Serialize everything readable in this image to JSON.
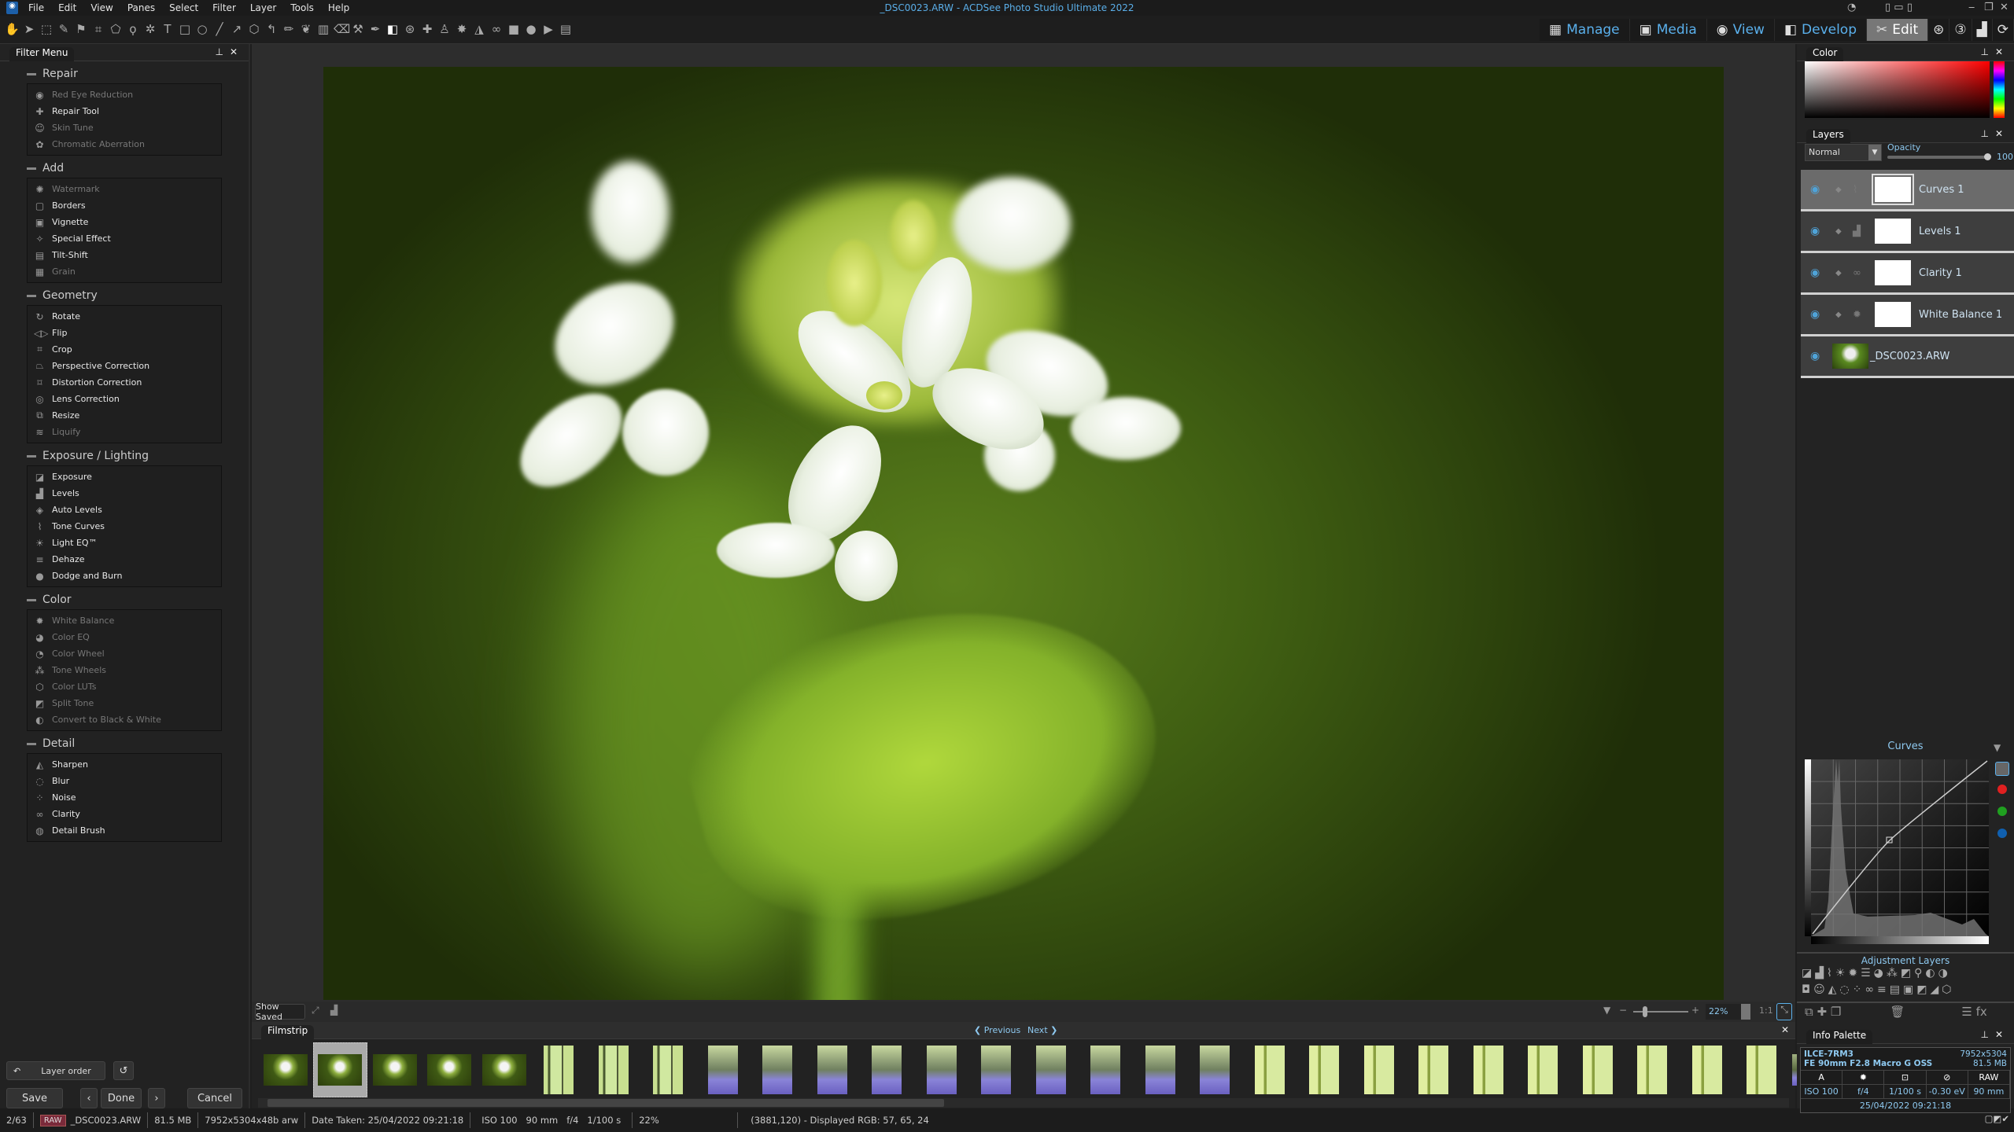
{
  "window": {
    "title": "_DSC0023.ARW - ACDSee Photo Studio Ultimate 2022"
  },
  "menu": [
    "File",
    "Edit",
    "View",
    "Panes",
    "Select",
    "Filter",
    "Layer",
    "Tools",
    "Help"
  ],
  "modes": [
    {
      "label": "Manage",
      "icon": "grid-icon"
    },
    {
      "label": "Media",
      "icon": "media-icon"
    },
    {
      "label": "View",
      "icon": "eye-icon"
    },
    {
      "label": "Develop",
      "icon": "develop-icon"
    },
    {
      "label": "Edit",
      "icon": "edit-icon",
      "active": true
    }
  ],
  "filter_menu": {
    "title": "Filter Menu",
    "sections": [
      {
        "title": "Repair",
        "items": [
          {
            "label": "Red Eye Reduction",
            "disabled": true,
            "icon": "◉"
          },
          {
            "label": "Repair Tool",
            "icon": "✚"
          },
          {
            "label": "Skin Tune",
            "disabled": true,
            "icon": "☺"
          },
          {
            "label": "Chromatic Aberration",
            "disabled": true,
            "icon": "✿"
          }
        ]
      },
      {
        "title": "Add",
        "items": [
          {
            "label": "Watermark",
            "disabled": true,
            "icon": "✺"
          },
          {
            "label": "Borders",
            "icon": "▢"
          },
          {
            "label": "Vignette",
            "icon": "▣"
          },
          {
            "label": "Special Effect",
            "icon": "✧"
          },
          {
            "label": "Tilt-Shift",
            "icon": "▤"
          },
          {
            "label": "Grain",
            "disabled": true,
            "icon": "▦"
          }
        ]
      },
      {
        "title": "Geometry",
        "items": [
          {
            "label": "Rotate",
            "icon": "↻"
          },
          {
            "label": "Flip",
            "icon": "◁▷"
          },
          {
            "label": "Crop",
            "icon": "⌗"
          },
          {
            "label": "Perspective Correction",
            "icon": "⏢"
          },
          {
            "label": "Distortion Correction",
            "icon": "⌑"
          },
          {
            "label": "Lens Correction",
            "icon": "◎"
          },
          {
            "label": "Resize",
            "icon": "⧉"
          },
          {
            "label": "Liquify",
            "disabled": true,
            "icon": "≋"
          }
        ]
      },
      {
        "title": "Exposure / Lighting",
        "items": [
          {
            "label": "Exposure",
            "icon": "◪"
          },
          {
            "label": "Levels",
            "icon": "▟"
          },
          {
            "label": "Auto Levels",
            "icon": "◈"
          },
          {
            "label": "Tone Curves",
            "icon": "⌇"
          },
          {
            "label": "Light EQ™",
            "icon": "☀"
          },
          {
            "label": "Dehaze",
            "icon": "≡"
          },
          {
            "label": "Dodge and Burn",
            "icon": "●"
          }
        ]
      },
      {
        "title": "Color",
        "items": [
          {
            "label": "White Balance",
            "disabled": true,
            "icon": "✹"
          },
          {
            "label": "Color EQ",
            "disabled": true,
            "icon": "◕"
          },
          {
            "label": "Color Wheel",
            "disabled": true,
            "icon": "◔"
          },
          {
            "label": "Tone Wheels",
            "disabled": true,
            "icon": "⁂"
          },
          {
            "label": "Color LUTs",
            "disabled": true,
            "icon": "⬡"
          },
          {
            "label": "Split Tone",
            "disabled": true,
            "icon": "◩"
          },
          {
            "label": "Convert to Black & White",
            "disabled": true,
            "icon": "◐"
          }
        ]
      },
      {
        "title": "Detail",
        "items": [
          {
            "label": "Sharpen",
            "icon": "◭"
          },
          {
            "label": "Blur",
            "icon": "◌"
          },
          {
            "label": "Noise",
            "icon": "⁘"
          },
          {
            "label": "Clarity",
            "icon": "∞"
          },
          {
            "label": "Detail Brush",
            "icon": "◍"
          }
        ]
      }
    ]
  },
  "left_buttons": {
    "layer_order": "Layer order",
    "save": "Save",
    "done": "Done",
    "cancel": "Cancel"
  },
  "viewer": {
    "show_saved": "Show Saved",
    "zoom": "22%",
    "one_to_one": "1:1"
  },
  "filmstrip": {
    "title": "Filmstrip",
    "previous": "Previous",
    "next": "Next",
    "selected_index": 1,
    "thumbs": [
      "flower",
      "flower",
      "flower",
      "flower",
      "flower",
      "forest",
      "forest",
      "forest",
      "bluebell",
      "bluebell",
      "bluebell",
      "bluebell",
      "bluebell",
      "bluebell",
      "bluebell",
      "bluebell",
      "bluebell",
      "bluebell",
      "green",
      "green",
      "green",
      "green",
      "green",
      "green",
      "green",
      "green",
      "green",
      "green",
      "bluebell-wide"
    ]
  },
  "status": {
    "index": "2/63",
    "raw": "RAW",
    "filename": "_DSC0023.ARW",
    "size": "81.5 MB",
    "dims": "7952x5304x48b arw",
    "date": "Date Taken: 25/04/2022 09:21:18",
    "exif": "ISO 100   90 mm   f/4   1/100 s",
    "zoom": "22%",
    "pixel": "(3881,120) - Displayed RGB: 57, 65, 24"
  },
  "color_panel": {
    "title": "Color"
  },
  "layers": {
    "title": "Layers",
    "blend_mode": "Normal",
    "opacity_label": "Opacity",
    "opacity": "100",
    "items": [
      {
        "name": "Curves 1",
        "icon": "⌇",
        "selected": true
      },
      {
        "name": "Levels 1",
        "icon": "▟"
      },
      {
        "name": "Clarity 1",
        "icon": "∞"
      },
      {
        "name": "White Balance 1",
        "icon": "✹"
      },
      {
        "name": "_DSC0023.ARW",
        "base": true
      }
    ]
  },
  "curves": {
    "title": "Curves"
  },
  "adjustment_layers": {
    "title": "Adjustment Layers"
  },
  "info": {
    "title": "Info Palette",
    "camera": "ILCE-7RM3",
    "lens": "FE 90mm F2.8 Macro G OSS",
    "dims": "7952x5304",
    "size": "81.5 MB",
    "mode": "A",
    "raw": "RAW",
    "iso": "ISO 100",
    "aperture": "f/4",
    "shutter": "1/100 s",
    "ev": "-0.30 eV",
    "focal": "90 mm",
    "date": "25/04/2022 09:21:18"
  },
  "colors": {
    "accent": "#5ab0ec",
    "selected_layer": "#6b6b6b"
  }
}
